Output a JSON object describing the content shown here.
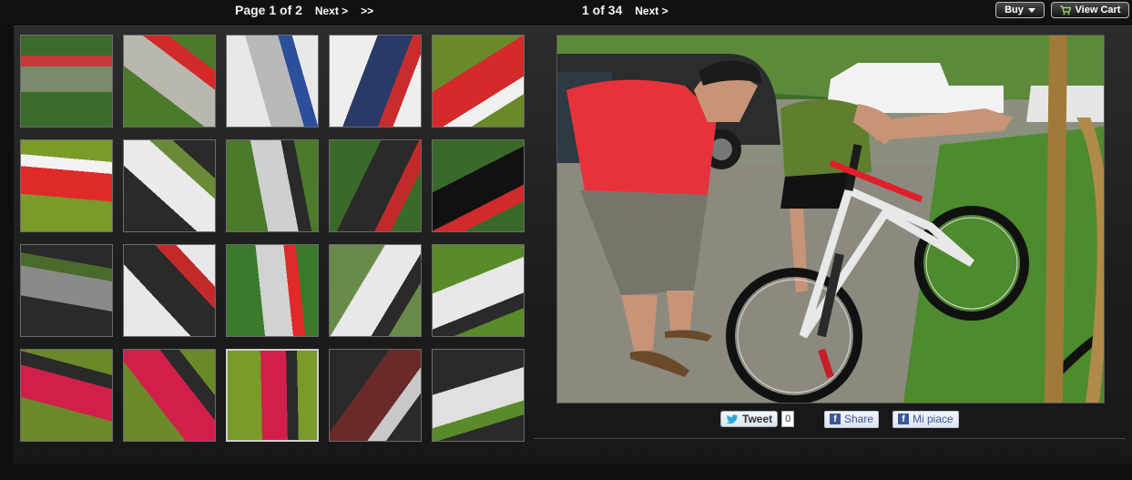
{
  "pager": {
    "page_label": "Page 1 of 2",
    "next_label": "Next >",
    "last_label": ">>"
  },
  "image_pager": {
    "count_label": "1 of 34",
    "next_label": "Next >"
  },
  "actions": {
    "buy_label": "Buy",
    "cart_label": "View Cart"
  },
  "social": {
    "tweet_label": "Tweet",
    "tweet_count": "0",
    "share_label": "Share",
    "like_label": "Mi piace"
  },
  "thumbnails": [
    {
      "row": 0,
      "col": 0,
      "palette": [
        "#3b6b2c",
        "#7a8a6a",
        "#c23a3a"
      ]
    },
    {
      "row": 0,
      "col": 1,
      "palette": [
        "#4b7a2a",
        "#b8b8b0",
        "#d22a2a"
      ]
    },
    {
      "row": 0,
      "col": 2,
      "palette": [
        "#e8e8e8",
        "#b9b9b9",
        "#2b4f9a"
      ]
    },
    {
      "row": 0,
      "col": 3,
      "palette": [
        "#eeeeee",
        "#2a3a66",
        "#c82c2c"
      ]
    },
    {
      "row": 0,
      "col": 4,
      "palette": [
        "#6a8a2a",
        "#d42a2a",
        "#f0f0f0"
      ]
    },
    {
      "row": 1,
      "col": 0,
      "palette": [
        "#7a9a2a",
        "#e02a2a",
        "#f2f2f2"
      ]
    },
    {
      "row": 1,
      "col": 1,
      "palette": [
        "#2a2a2a",
        "#eaeaea",
        "#6a8a3a"
      ]
    },
    {
      "row": 1,
      "col": 2,
      "palette": [
        "#4a7a2a",
        "#cfcfcf",
        "#2a2a2a"
      ]
    },
    {
      "row": 1,
      "col": 3,
      "palette": [
        "#3a6a2a",
        "#2a2a2a",
        "#c22a2a"
      ]
    },
    {
      "row": 1,
      "col": 4,
      "palette": [
        "#3a6a2a",
        "#111111",
        "#d22a2a"
      ]
    },
    {
      "row": 2,
      "col": 0,
      "palette": [
        "#2a2a2a",
        "#8a8a8a",
        "#4a6a2a"
      ]
    },
    {
      "row": 2,
      "col": 1,
      "palette": [
        "#e8e8e8",
        "#2a2a2a",
        "#c22a2a"
      ]
    },
    {
      "row": 2,
      "col": 2,
      "palette": [
        "#3a7a2a",
        "#d2d2d2",
        "#e02a2a"
      ]
    },
    {
      "row": 2,
      "col": 3,
      "palette": [
        "#6a8a4a",
        "#e8e8e8",
        "#2a2a2a"
      ]
    },
    {
      "row": 2,
      "col": 4,
      "palette": [
        "#5a8a2a",
        "#e8e8e8",
        "#2a2a2a"
      ]
    },
    {
      "row": 3,
      "col": 0,
      "palette": [
        "#6a8a2a",
        "#d0204a",
        "#2a2a2a"
      ]
    },
    {
      "row": 3,
      "col": 1,
      "palette": [
        "#6a8a2a",
        "#d0204a",
        "#2a2a2a"
      ]
    },
    {
      "row": 3,
      "col": 2,
      "palette": [
        "#7a9a2a",
        "#d0204a",
        "#2a2a2a"
      ],
      "selected": true
    },
    {
      "row": 3,
      "col": 3,
      "palette": [
        "#2a2a2a",
        "#6a2a2a",
        "#c8c8c8"
      ]
    },
    {
      "row": 3,
      "col": 4,
      "palette": [
        "#2a2a2a",
        "#e0e0e0",
        "#5a8a2a"
      ]
    }
  ]
}
